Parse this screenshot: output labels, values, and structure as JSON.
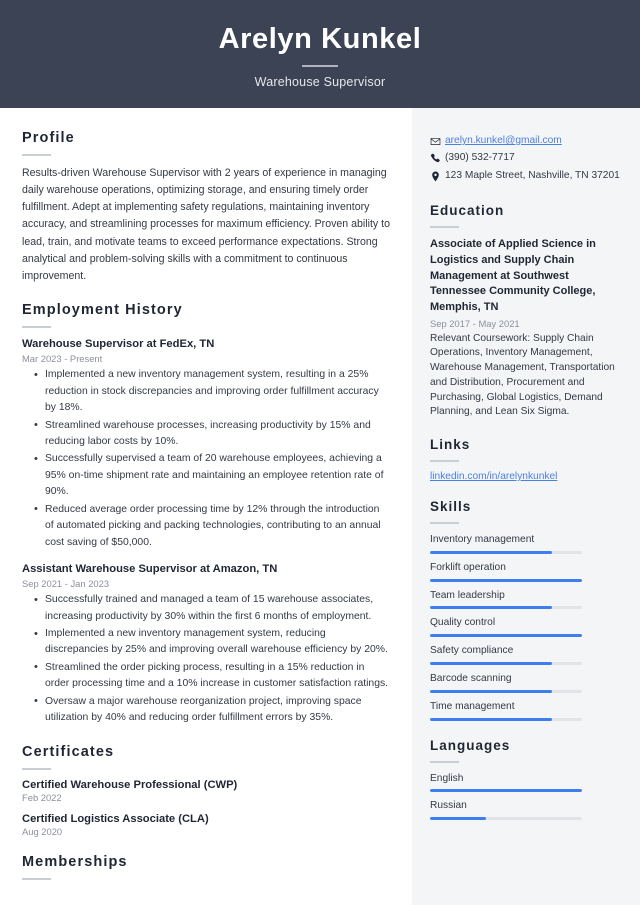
{
  "header": {
    "name": "Arelyn Kunkel",
    "job_title": "Warehouse Supervisor"
  },
  "theme": {
    "header_bg": "#3b4354",
    "sidebar_bg": "#f4f5f7",
    "accent": "#3b7ff0",
    "link": "#4a7fe0",
    "heading": "#1f2633",
    "muted": "#8b909b"
  },
  "main": {
    "profile": {
      "heading": "Profile",
      "text": "Results-driven Warehouse Supervisor with 2 years of experience in managing daily warehouse operations, optimizing storage, and ensuring timely order fulfillment. Adept at implementing safety regulations, maintaining inventory accuracy, and streamlining processes for maximum efficiency. Proven ability to lead, train, and motivate teams to exceed performance expectations. Strong analytical and problem-solving skills with a commitment to continuous improvement."
    },
    "employment": {
      "heading": "Employment History",
      "jobs": [
        {
          "title": "Warehouse Supervisor at FedEx, TN",
          "date": "Mar 2023 - Present",
          "bullets": [
            "Implemented a new inventory management system, resulting in a 25% reduction in stock discrepancies and improving order fulfillment accuracy by 18%.",
            "Streamlined warehouse processes, increasing productivity by 15% and reducing labor costs by 10%.",
            "Successfully supervised a team of 20 warehouse employees, achieving a 95% on-time shipment rate and maintaining an employee retention rate of 90%.",
            "Reduced average order processing time by 12% through the introduction of automated picking and packing technologies, contributing to an annual cost saving of $50,000."
          ]
        },
        {
          "title": "Assistant Warehouse Supervisor at Amazon, TN",
          "date": "Sep 2021 - Jan 2023",
          "bullets": [
            "Successfully trained and managed a team of 15 warehouse associates, increasing productivity by 30% within the first 6 months of employment.",
            "Implemented a new inventory management system, reducing discrepancies by 25% and improving overall warehouse efficiency by 20%.",
            "Streamlined the order picking process, resulting in a 15% reduction in order processing time and a 10% increase in customer satisfaction ratings.",
            "Oversaw a major warehouse reorganization project, improving space utilization by 40% and reducing order fulfillment errors by 35%."
          ]
        }
      ]
    },
    "certificates": {
      "heading": "Certificates",
      "items": [
        {
          "title": "Certified Warehouse Professional (CWP)",
          "date": "Feb 2022"
        },
        {
          "title": "Certified Logistics Associate (CLA)",
          "date": "Aug 2020"
        }
      ]
    },
    "memberships": {
      "heading": "Memberships"
    }
  },
  "sidebar": {
    "contact": [
      {
        "icon": "envelope-icon",
        "text": "arelyn.kunkel@gmail.com",
        "is_link": true
      },
      {
        "icon": "phone-icon",
        "text": "(390) 532-7717",
        "is_link": false
      },
      {
        "icon": "location-pin-icon",
        "text": "123 Maple Street, Nashville, TN 37201",
        "is_link": false
      }
    ],
    "education": {
      "heading": "Education",
      "degree": "Associate of Applied Science in Logistics and Supply Chain Management at Southwest Tennessee Community College, Memphis, TN",
      "date": "Sep 2017 - May 2021",
      "description": "Relevant Coursework: Supply Chain Operations, Inventory Management, Warehouse Management, Transportation and Distribution, Procurement and Purchasing, Global Logistics, Demand Planning, and Lean Six Sigma."
    },
    "links": {
      "heading": "Links",
      "items": [
        {
          "label": "linkedin.com/in/arelynkunkel"
        }
      ]
    },
    "skills": {
      "heading": "Skills",
      "items": [
        {
          "label": "Inventory management",
          "level": 80
        },
        {
          "label": "Forklift operation",
          "level": 100
        },
        {
          "label": "Team leadership",
          "level": 80
        },
        {
          "label": "Quality control",
          "level": 100
        },
        {
          "label": "Safety compliance",
          "level": 80
        },
        {
          "label": "Barcode scanning",
          "level": 80
        },
        {
          "label": "Time management",
          "level": 80
        }
      ]
    },
    "languages": {
      "heading": "Languages",
      "items": [
        {
          "label": "English",
          "level": 100
        },
        {
          "label": "Russian",
          "level": 37
        }
      ]
    }
  }
}
